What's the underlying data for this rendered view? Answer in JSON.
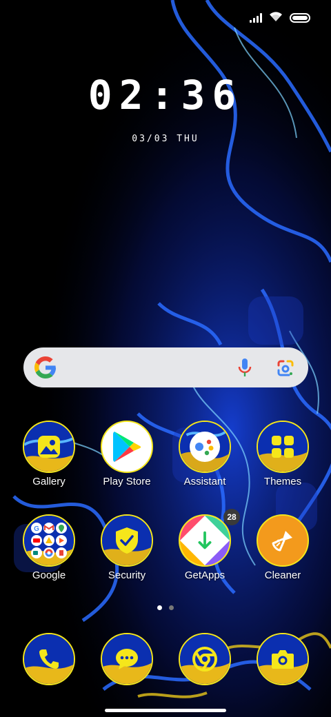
{
  "status_bar": {
    "icons": [
      "signal-icon",
      "wifi-icon",
      "battery-icon"
    ]
  },
  "clock": {
    "time": "02:36",
    "date": "03/03 THU"
  },
  "search": {
    "icons": [
      "google-logo-icon",
      "mic-icon",
      "google-lens-icon"
    ]
  },
  "apps": [
    {
      "label": "Gallery"
    },
    {
      "label": "Play Store"
    },
    {
      "label": "Assistant"
    },
    {
      "label": "Themes"
    },
    {
      "label": "Google"
    },
    {
      "label": "Security"
    },
    {
      "label": "GetApps",
      "badge": "28"
    },
    {
      "label": "Cleaner"
    }
  ],
  "dock": [
    {
      "icon": "phone-icon"
    },
    {
      "icon": "messages-icon"
    },
    {
      "icon": "chrome-icon"
    },
    {
      "icon": "camera-icon"
    }
  ],
  "page_indicator": {
    "total": 2,
    "current": 1
  },
  "colors": {
    "icon_ring": "#f5e61b",
    "wallpaper_blue": "#1e4fff",
    "search_bg": "#e6e7ea"
  }
}
